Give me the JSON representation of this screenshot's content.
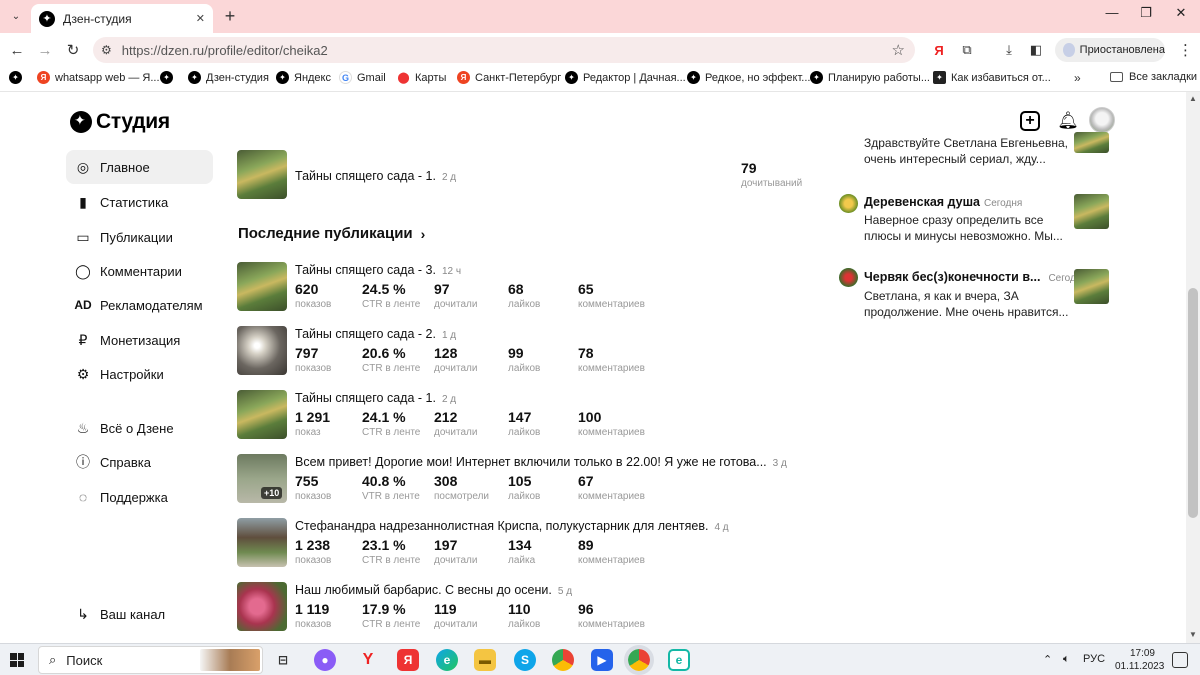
{
  "browser": {
    "tab_title": "Дзен-студия",
    "url": "https://dzen.ru/profile/editor/cheika2",
    "profile_status": "Приостановлена",
    "bookmarks": [
      {
        "label": "whatsapp web — Я...",
        "icon": "yandex-icon"
      },
      {
        "label": "Дзен-студия",
        "icon": "dzen-icon"
      },
      {
        "label": "Яндекс",
        "icon": "dzen-icon"
      },
      {
        "label": "Gmail",
        "icon": "google-icon"
      },
      {
        "label": "Карты",
        "icon": "map-pin-icon"
      },
      {
        "label": "Санкт-Петербург",
        "icon": "yandex-icon"
      },
      {
        "label": "Редактор | Дачная...",
        "icon": "dzen-icon"
      },
      {
        "label": "Редкое, но эффект...",
        "icon": "dzen-icon"
      },
      {
        "label": "Планирую работы...",
        "icon": "dzen-icon"
      },
      {
        "label": "Как избавиться от...",
        "icon": "square-icon"
      }
    ],
    "all_bookmarks": "Все закладки"
  },
  "studio": {
    "logo": "Студия",
    "nav": [
      {
        "label": "Главное",
        "icon": "home-icon"
      },
      {
        "label": "Статистика",
        "icon": "chart-icon"
      },
      {
        "label": "Публикации",
        "icon": "publications-icon"
      },
      {
        "label": "Комментарии",
        "icon": "comments-icon"
      },
      {
        "label": "Рекламодателям",
        "icon": "ad-icon"
      },
      {
        "label": "Монетизация",
        "icon": "ruble-icon"
      },
      {
        "label": "Настройки",
        "icon": "gear-icon"
      }
    ],
    "nav_secondary": [
      {
        "label": "Всё о Дзене",
        "icon": "flame-icon"
      },
      {
        "label": "Справка",
        "icon": "help-icon"
      },
      {
        "label": "Поддержка",
        "icon": "support-icon"
      }
    ],
    "channel_link": "Ваш канал"
  },
  "top_pub": {
    "title": "Тайны спящего сада - 1.",
    "age": "2 д",
    "value": "79",
    "label": "дочитываний"
  },
  "latest": {
    "heading": "Последние публикации",
    "items": [
      {
        "title": "Тайны спящего сада - 3.",
        "age": "12 ч",
        "stats": [
          [
            "620",
            "показов"
          ],
          [
            "24.5 %",
            "CTR в ленте"
          ],
          [
            "97",
            "дочитали"
          ],
          [
            "68",
            "лайков"
          ],
          [
            "65",
            "комментариев"
          ]
        ]
      },
      {
        "title": "Тайны спящего сада - 2.",
        "age": "1 д",
        "stats": [
          [
            "797",
            "показов"
          ],
          [
            "20.6 %",
            "CTR в ленте"
          ],
          [
            "128",
            "дочитали"
          ],
          [
            "99",
            "лайков"
          ],
          [
            "78",
            "комментариев"
          ]
        ]
      },
      {
        "title": "Тайны спящего сада - 1.",
        "age": "2 д",
        "stats": [
          [
            "1 291",
            "показ"
          ],
          [
            "24.1 %",
            "CTR в ленте"
          ],
          [
            "212",
            "дочитали"
          ],
          [
            "147",
            "лайков"
          ],
          [
            "100",
            "комментариев"
          ]
        ]
      },
      {
        "title": "Всем привет! Дорогие мои! Интернет включили только в 22.00! Я уже не готова...",
        "age": "3 д",
        "badge": "+10",
        "stats": [
          [
            "755",
            "показов"
          ],
          [
            "40.8 %",
            "VTR в ленте"
          ],
          [
            "308",
            "посмотрели"
          ],
          [
            "105",
            "лайков"
          ],
          [
            "67",
            "комментариев"
          ]
        ]
      },
      {
        "title": "Стефанандра надрезаннолистная Криспа, полукустарник для лентяев.",
        "age": "4 д",
        "stats": [
          [
            "1 238",
            "показов"
          ],
          [
            "23.1 %",
            "CTR в ленте"
          ],
          [
            "197",
            "дочитали"
          ],
          [
            "134",
            "лайка"
          ],
          [
            "89",
            "комментариев"
          ]
        ]
      },
      {
        "title": "Наш любимый барбарис. С весны до осени.",
        "age": "5 д",
        "stats": [
          [
            "1 119",
            "показов"
          ],
          [
            "17.9 %",
            "CTR в ленте"
          ],
          [
            "119",
            "дочитали"
          ],
          [
            "110",
            "лайков"
          ],
          [
            "96",
            "комментариев"
          ]
        ]
      }
    ]
  },
  "comments": [
    {
      "author": "",
      "time": "",
      "text": "Здравствуйте Светлана Евгеньевна, очень интересный сериал, жду..."
    },
    {
      "author": "Деревенская душа",
      "time": "Сегодня",
      "text": "Наверное сразу определить все плюсы и минусы невозможно. Мы..."
    },
    {
      "author": "Червяк бес(з)конечности в...",
      "time": "Сегодня",
      "text": "Светлана, я как и вчера, ЗА продолжение. Мне очень нравится..."
    }
  ],
  "taskbar": {
    "search": "Поиск",
    "lang": "РУС",
    "time": "17:09",
    "date": "01.11.2023"
  },
  "colors": {
    "tab_strip": "#fbd7d8",
    "omnibox": "#f7ebeb",
    "active_nav": "#f0f0f0"
  }
}
